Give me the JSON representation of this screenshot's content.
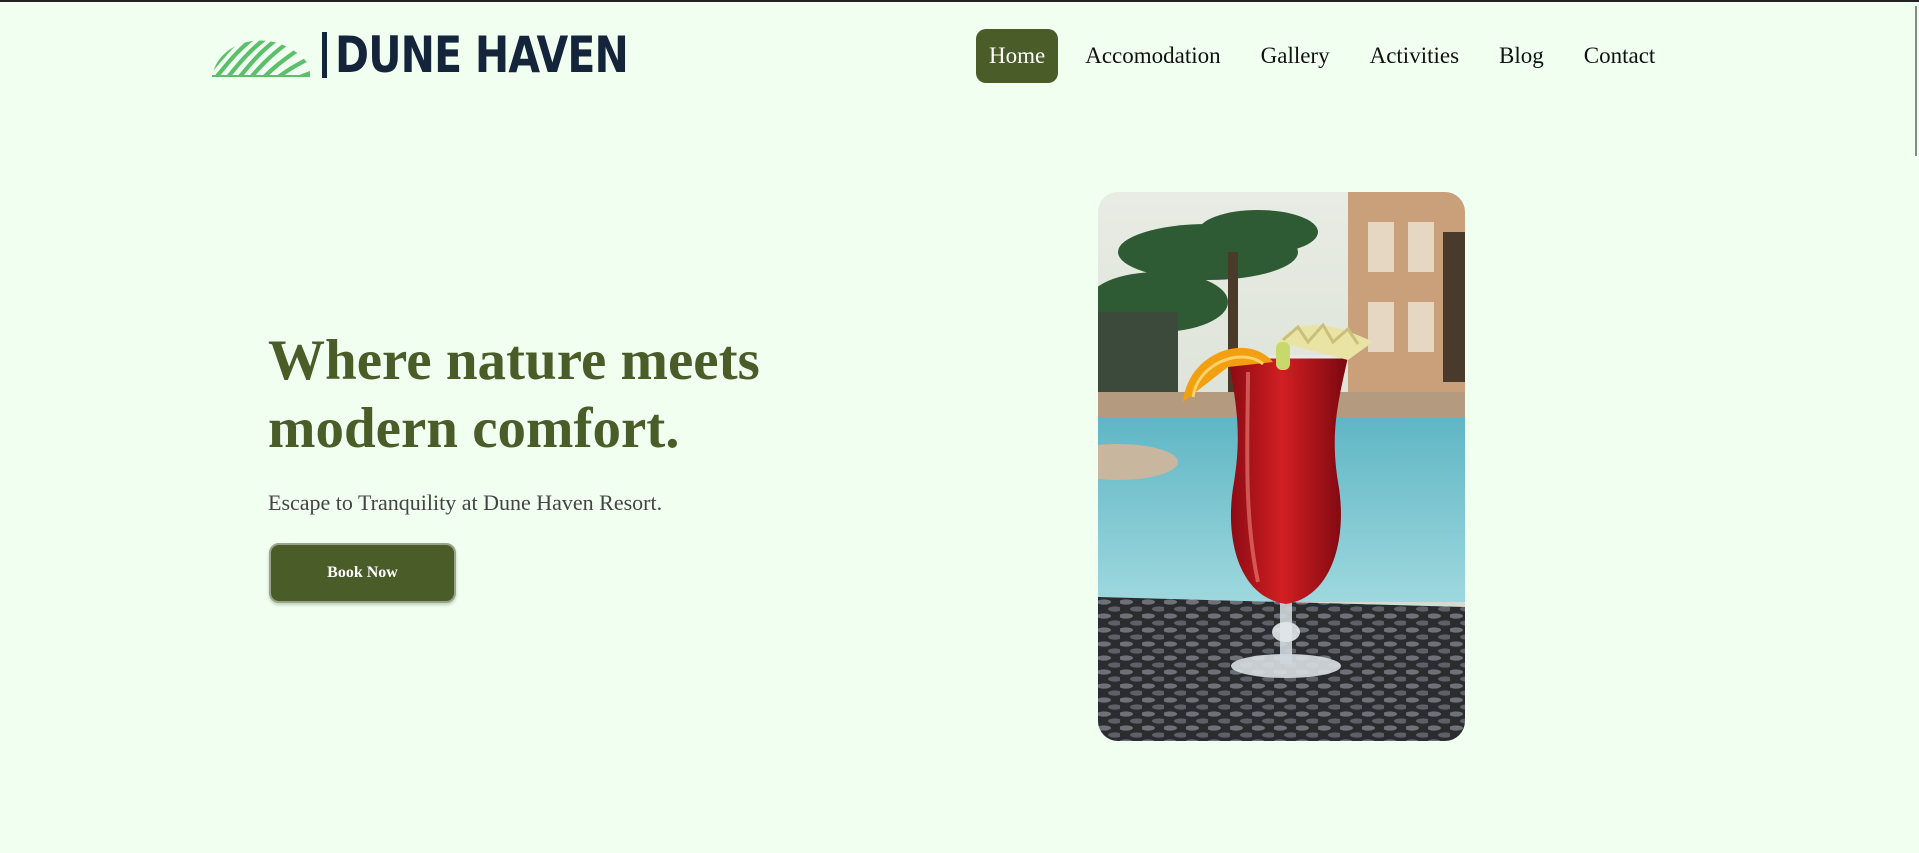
{
  "brand": {
    "name": "DUNE HAVEN",
    "logo_icon": "dune-waves-logo",
    "colors": {
      "primary": "#4a5c28",
      "navy": "#14243a",
      "logo_green": "#5cbf6c",
      "background": "#f0fff0"
    }
  },
  "nav": {
    "items": [
      {
        "label": "Home",
        "active": true
      },
      {
        "label": "Accomodation",
        "active": false
      },
      {
        "label": "Gallery",
        "active": false
      },
      {
        "label": "Activities",
        "active": false
      },
      {
        "label": "Blog",
        "active": false
      },
      {
        "label": "Contact",
        "active": false
      }
    ]
  },
  "hero": {
    "title": "Where nature meets modern comfort.",
    "subtitle": "Escape to Tranquility at Dune Haven Resort.",
    "cta_label": "Book Now",
    "image_icon": "cocktail-poolside-photo"
  }
}
